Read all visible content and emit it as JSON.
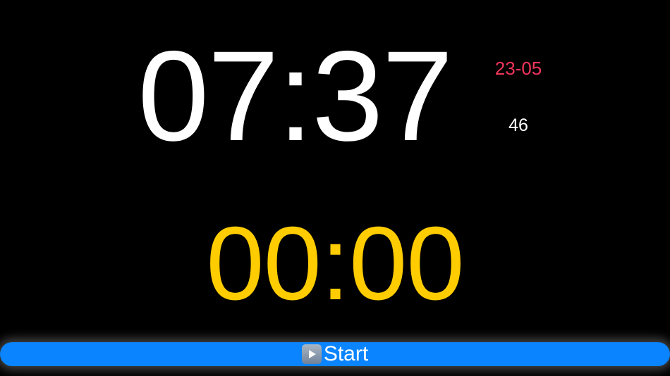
{
  "clock": {
    "time": "07:37",
    "date": "23-05",
    "seconds": "46"
  },
  "timer": {
    "display": "00:00"
  },
  "controls": {
    "start_label": "Start",
    "start_icon": "play-icon"
  },
  "colors": {
    "background": "#000000",
    "clock_text": "#ffffff",
    "date_text": "#f0355a",
    "timer_text": "#ffcc00",
    "button_bg": "#0a84ff"
  }
}
